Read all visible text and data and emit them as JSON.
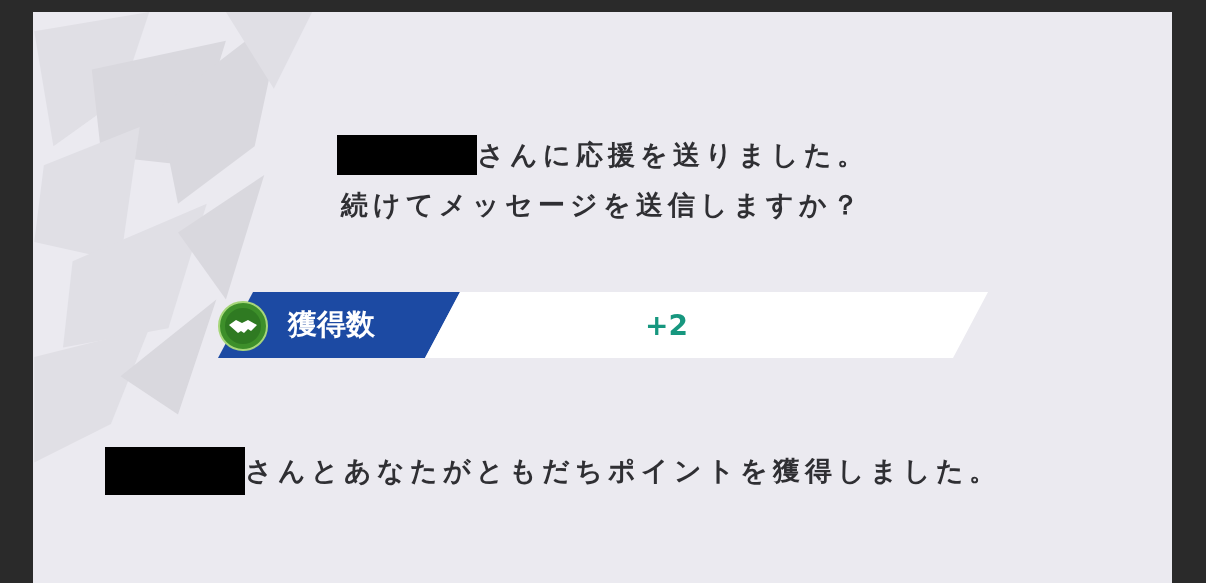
{
  "message": {
    "lines": [
      {
        "text": "さんに応援を送りました。",
        "redacted_name": true
      },
      {
        "text": "続けてメッセージを送信しますか？",
        "redacted_name": false
      }
    ]
  },
  "reward": {
    "label": "獲得数",
    "value": "+2"
  },
  "result": {
    "text": "さんとあなたがともだちポイントを獲得しました。",
    "redacted_name": true
  }
}
